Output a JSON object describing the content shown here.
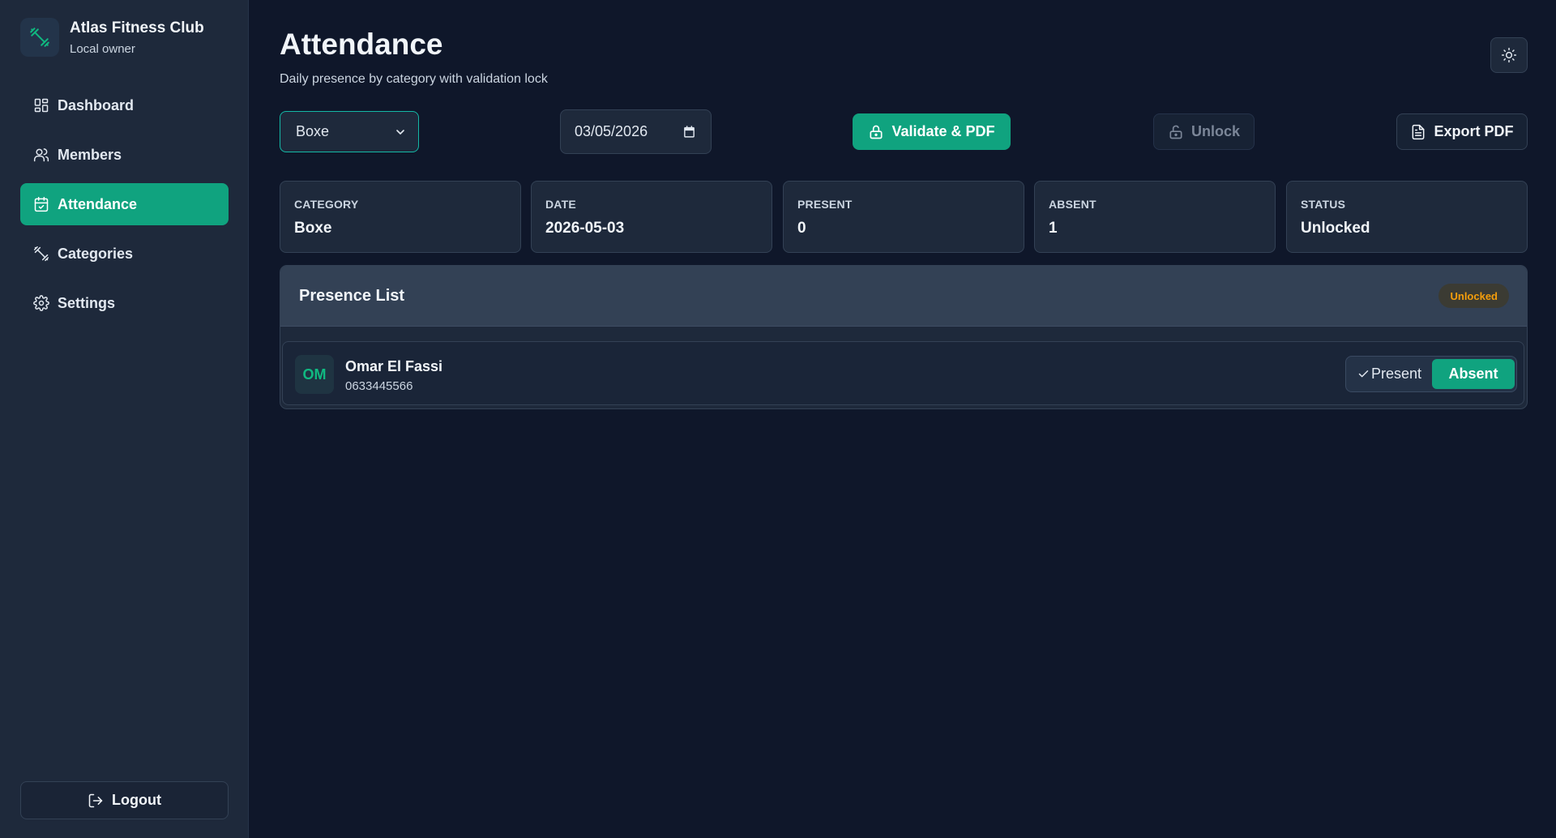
{
  "brand": {
    "name": "Atlas Fitness Club",
    "subtitle": "Local owner",
    "icon": "dumbbell-icon"
  },
  "sidebar": {
    "items": [
      {
        "label": "Dashboard",
        "icon": "grid-icon"
      },
      {
        "label": "Members",
        "icon": "users-icon"
      },
      {
        "label": "Attendance",
        "icon": "calendar-check-icon",
        "active": true
      },
      {
        "label": "Categories",
        "icon": "dumbbell-icon"
      },
      {
        "label": "Settings",
        "icon": "gear-icon"
      }
    ],
    "logout_label": "Logout"
  },
  "header": {
    "title": "Attendance",
    "subtitle": "Daily presence by category with validation lock",
    "theme_icon": "sun-icon"
  },
  "toolbar": {
    "category_value": "Boxe",
    "date_value": "03/05/2026",
    "validate_label": "Validate & PDF",
    "unlock_label": "Unlock",
    "export_label": "Export PDF"
  },
  "stats": [
    {
      "label": "Category",
      "value": "Boxe"
    },
    {
      "label": "Date",
      "value": "2026-05-03"
    },
    {
      "label": "Present",
      "value": "0"
    },
    {
      "label": "Absent",
      "value": "1"
    },
    {
      "label": "Status",
      "value": "Unlocked"
    }
  ],
  "presence": {
    "title": "Presence List",
    "badge": "Unlocked",
    "members": [
      {
        "initials": "OM",
        "name": "Omar El Fassi",
        "phone": "0633445566",
        "present_label": "Present",
        "absent_label": "Absent",
        "selected": "Absent"
      }
    ]
  },
  "colors": {
    "accent": "#10a37f",
    "background": "#0f172a",
    "surface": "#1e293b",
    "badge_warning": "#f59e0b"
  }
}
